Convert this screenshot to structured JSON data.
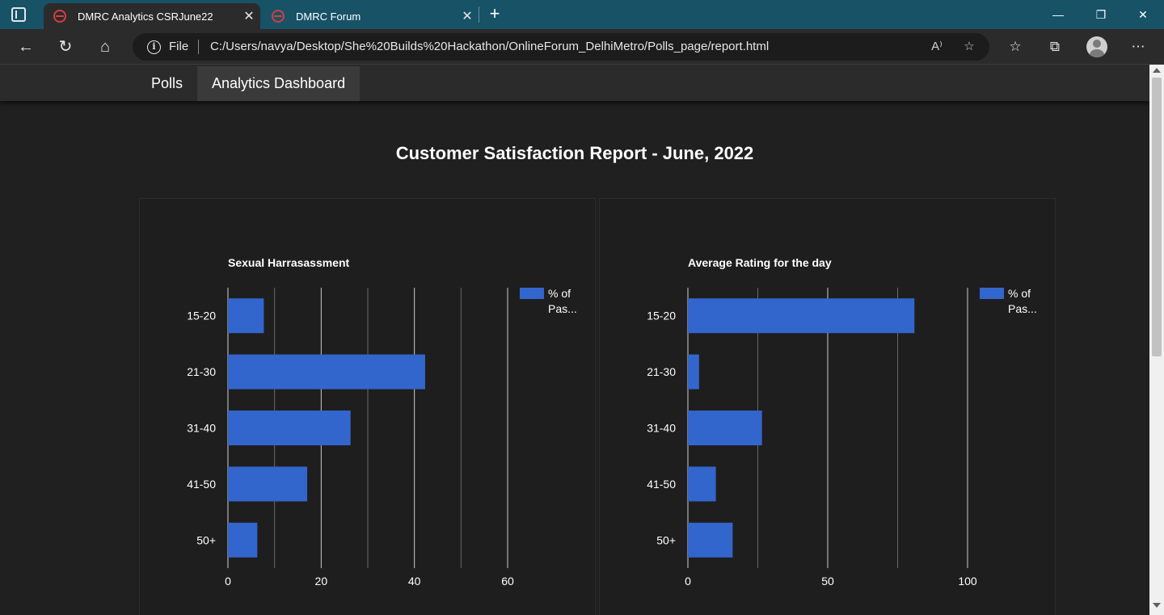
{
  "browser": {
    "tabs": [
      {
        "title": "DMRC Analytics CSRJune22",
        "close": "✕",
        "active": true
      },
      {
        "title": "DMRC Forum",
        "close": "✕",
        "active": false
      }
    ],
    "new_tab": "+",
    "window_controls": {
      "minimize": "—",
      "restore": "❐",
      "close": "✕"
    },
    "address": {
      "scheme_label": "File",
      "url": "C:/Users/navya/Desktop/She%20Builds%20Hackathon/OnlineForum_DelhiMetro/Polls_page/report.html"
    },
    "icons": {
      "back": "←",
      "refresh": "↻",
      "home": "⌂",
      "info": "i",
      "read_aloud": "A⁾",
      "add_favorite": "☆",
      "favorites": "☆",
      "collections": "⧉",
      "more": "⋯"
    }
  },
  "page": {
    "nav": {
      "polls": "Polls",
      "analytics": "Analytics Dashboard"
    },
    "report_title": "Customer Satisfaction Report - June, 2022"
  },
  "chart_data": [
    {
      "type": "bar",
      "orientation": "horizontal",
      "title": "Sexual Harrasassment",
      "categories": [
        "15-20",
        "21-30",
        "31-40",
        "41-50",
        "50+"
      ],
      "series": [
        {
          "name": "% of Pas...",
          "values": [
            7.7,
            42.3,
            26.3,
            17.0,
            6.3
          ],
          "color": "#3366cc"
        }
      ],
      "xlim": [
        0,
        60
      ],
      "xticks": [
        0,
        20,
        40,
        60
      ],
      "xgrid_step": 10,
      "legend": "top-right",
      "grid": true
    },
    {
      "type": "bar",
      "orientation": "horizontal",
      "title": "Average Rating for the day",
      "categories": [
        "15-20",
        "21-30",
        "31-40",
        "41-50",
        "50+"
      ],
      "series": [
        {
          "name": "% of Pas...",
          "values": [
            81,
            4,
            26.5,
            10,
            16
          ],
          "color": "#3366cc"
        }
      ],
      "xlim": [
        0,
        100
      ],
      "xticks": [
        0,
        50,
        100
      ],
      "xgrid_step": 25,
      "legend": "top-right",
      "grid": true
    }
  ]
}
